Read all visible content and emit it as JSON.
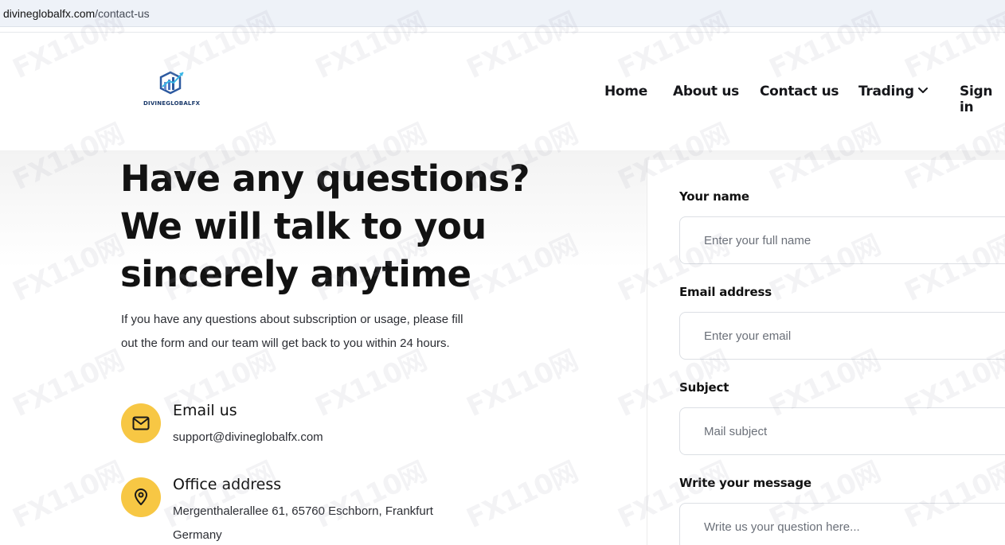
{
  "browser": {
    "url_domain": "divineglobalfx.com",
    "url_path": "/contact-us"
  },
  "header": {
    "logo_text": "DIVINEGLOBALFX",
    "nav": {
      "home": "Home",
      "about": "About us",
      "contact": "Contact us",
      "trading": "Trading",
      "signin": "Sign in"
    }
  },
  "hero": {
    "title_line1": "Have any questions?",
    "title_line2": "We will talk to you",
    "title_line3": "sincerely anytime",
    "desc_line1": "If you have any questions about subscription or usage, please fill",
    "desc_line2": "out the form and our team will get back to you within 24 hours."
  },
  "contact_info": {
    "email_title": "Email us",
    "email_value": "support@divineglobalfx.com",
    "office_title": "Office address",
    "office_line1": "Mergenthalerallee 61, 65760 Eschborn, Frankfurt",
    "office_line2": "Germany"
  },
  "form": {
    "name_label": "Your name",
    "name_placeholder": "Enter your full name",
    "email_label": "Email address",
    "email_placeholder": "Enter your email",
    "subject_label": "Subject",
    "subject_placeholder": "Mail subject",
    "message_label": "Write your message",
    "message_placeholder": "Write us your question here..."
  },
  "colors": {
    "accent_yellow": "#f7c744",
    "text_dark": "#121212",
    "url_bar_bg": "#eef2f8"
  },
  "watermark_text": "FX110网"
}
